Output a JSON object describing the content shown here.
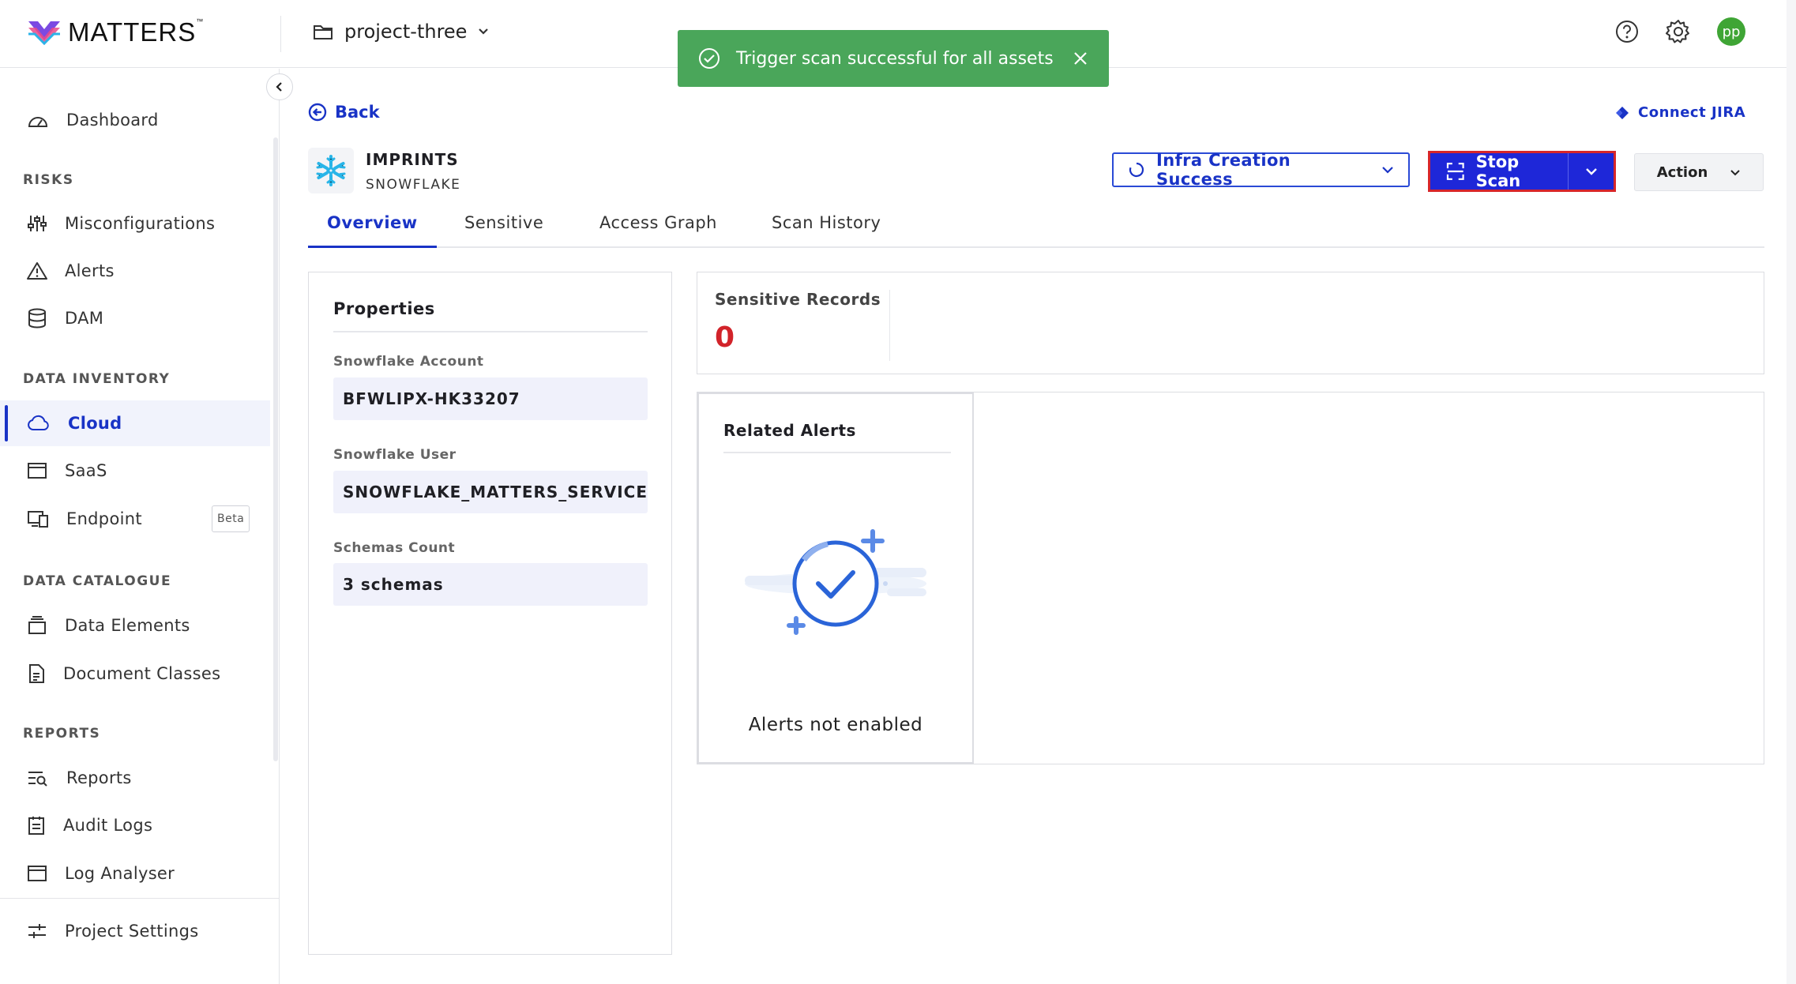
{
  "app": {
    "logo_text": "MATTERS",
    "logo_tm": "™"
  },
  "header": {
    "project_name": "project-three",
    "avatar_initials": "pp"
  },
  "toast": {
    "message": "Trigger scan successful for all assets",
    "color": "#4aa65a"
  },
  "sidebar": {
    "dashboard": "Dashboard",
    "sections": {
      "risks": "RISKS",
      "data_inventory": "DATA INVENTORY",
      "data_catalogue": "DATA CATALOGUE",
      "reports": "REPORTS"
    },
    "items": {
      "misconfigurations": "Misconfigurations",
      "alerts": "Alerts",
      "dam": "DAM",
      "cloud": "Cloud",
      "saas": "SaaS",
      "endpoint": "Endpoint",
      "endpoint_badge": "Beta",
      "data_elements": "Data Elements",
      "document_classes": "Document Classes",
      "reports": "Reports",
      "audit_logs": "Audit Logs",
      "log_analyser": "Log Analyser",
      "project_settings": "Project Settings"
    },
    "active_item": "Cloud"
  },
  "page": {
    "back_label": "Back",
    "connect_jira_label": "Connect JIRA",
    "asset_name": "IMPRINTS",
    "asset_type": "SNOWFLAKE",
    "infra_status_label": "Infra Creation Success",
    "stop_scan_label": "Stop Scan",
    "action_label": "Action",
    "tabs": [
      "Overview",
      "Sensitive",
      "Access Graph",
      "Scan History"
    ],
    "active_tab": "Overview"
  },
  "properties": {
    "title": "Properties",
    "fields": [
      {
        "label": "Snowflake Account",
        "value": "BFWLIPX-HK33207"
      },
      {
        "label": "Snowflake User",
        "value": "SNOWFLAKE_MATTERS_SERVICE"
      },
      {
        "label": "Schemas Count",
        "value": "3 schemas"
      }
    ]
  },
  "sensitive_records": {
    "title": "Sensitive Records",
    "value": "0"
  },
  "related_alerts": {
    "title": "Related Alerts",
    "empty_message": "Alerts not enabled"
  },
  "colors": {
    "accent": "#1933c6",
    "stop_scan_bg": "#1e27d8",
    "danger": "#d2232a"
  }
}
